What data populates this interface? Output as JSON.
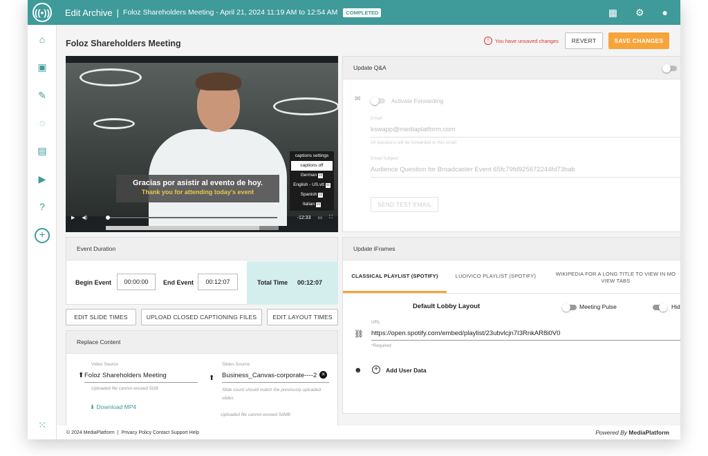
{
  "app": {
    "edit_title": "Edit Archive",
    "event_title": "Foloz Shareholders Meeting - April 21, 2024 11:19 AM to 12:54 AM",
    "status_badge": "COMPLETED",
    "logo_text": "((•))"
  },
  "header_icons": [
    "grid-icon",
    "gear-icon",
    "account-icon"
  ],
  "sidebar": [
    "home-icon",
    "calendar-icon",
    "brush-icon",
    "circle-icon",
    "chart-icon",
    "replay-icon",
    "help-icon",
    "add-icon",
    "apps-icon"
  ],
  "page": {
    "title": "Foloz Shareholders Meeting",
    "unsaved": "You have unsaved changes",
    "revert": "REVERT",
    "save": "SAVE CHANGES"
  },
  "video": {
    "caption_es": "Gracias por asistir al evento de hoy.",
    "caption_en": "Thank you for attending today's event",
    "menu_title": "captions settings",
    "menu_items": [
      "captions off",
      "German",
      "English - US.vtt",
      "Spanish",
      "Italian"
    ],
    "cc_label": "cc",
    "time": "-12:33"
  },
  "event_duration": {
    "header": "Event Duration",
    "begin_label": "Begin Event",
    "begin_value": "00:00:00",
    "end_label": "End Event",
    "end_value": "00:12:07",
    "total_label": "Total Time",
    "total_value": "00:12:07"
  },
  "action_buttons": [
    "EDIT SLIDE TIMES",
    "UPLOAD CLOSED CAPTIONING FILES",
    "EDIT LAYOUT TIMES"
  ],
  "replace": {
    "header": "Replace Content",
    "video_label": "Video Source",
    "video_value": "Foloz Shareholders Meeting",
    "video_hint": "Uploaded file cannot exceed 5GB",
    "download": "Download MP4",
    "slides_label": "Slides Source",
    "slides_value": "Business_Canvas-corporate----2",
    "slides_hint": "Slide count should match the previously uploaded slides",
    "slides_hint2": "Uploaded file cannot exceed 50MB"
  },
  "qa": {
    "header": "Update Q&A",
    "forwarding": "Activate Forwarding",
    "email_label": "Email",
    "email_value": "kswapp@mediaplatform.com",
    "email_hint": "All questions will be forwarded to this email",
    "subject_label": "Email Subject",
    "subject_value": "Audience Question for Broadcaster Event 65fc79fd925672244fd73bab",
    "send_test": "SEND TEST EMAIL"
  },
  "iframes": {
    "header": "Update iFrames",
    "tabs": [
      "CLASSICAL PLAYLIST (SPOTIFY)",
      "LUDIVICO PLAYLIST (SPOTIFY)",
      "WIKIPEDIA FOR A LONG TITLE TO VIEW IN MO VIEW TABS"
    ],
    "lobby": "Default Lobby Layout",
    "pulse": "Meeting Pulse",
    "hide": "Hid",
    "url_label": "URL",
    "url_value": "https://open.spotify.com/embed/playlist/23ubvlcjn7I3RnkAR8i0V0",
    "required": "*Required",
    "add_user": "Add User Data"
  },
  "footer": {
    "copyright": "© 2024 MediaPlatform",
    "links": "Privacy Policy  Contact Support  Help",
    "powered": "Powered By",
    "brand": "MediaPlatform"
  },
  "colors": {
    "teal": "#3f9a9a",
    "orange": "#f7a43a",
    "total_bg": "#d4eeee"
  }
}
